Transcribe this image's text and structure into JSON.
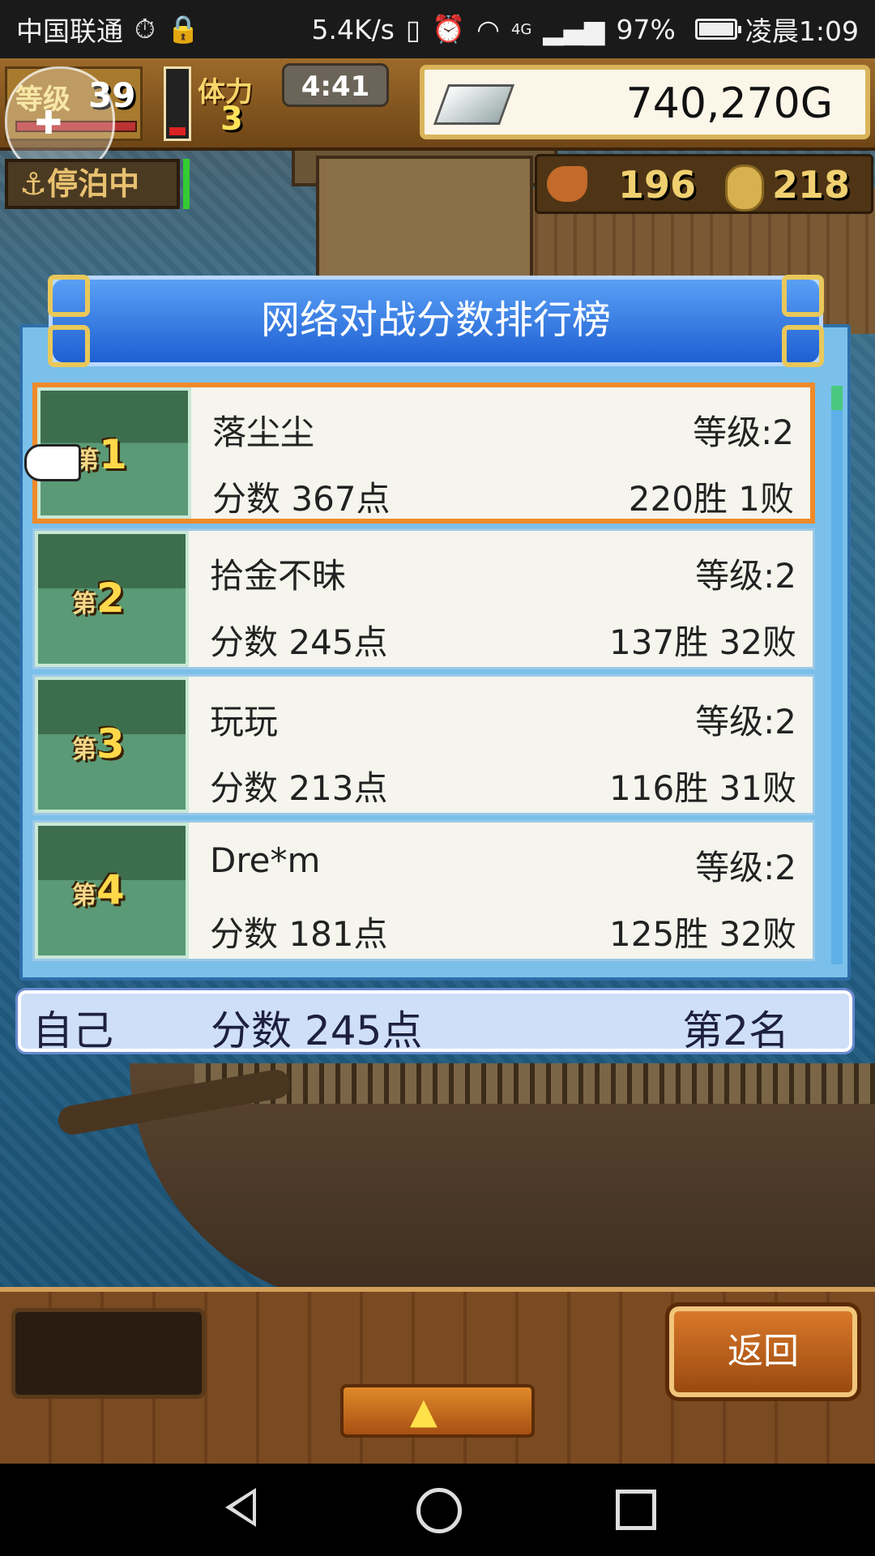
{
  "status_bar": {
    "carrier": "中国联通",
    "network_speed": "5.4K/s",
    "signal_label": "4G",
    "battery": "97%",
    "time": "凌晨1:09"
  },
  "hud": {
    "level_label": "等级",
    "level_value": "39",
    "stamina_label": "体力",
    "stamina_value": "3",
    "timer": "4:41",
    "money": "740,270G",
    "status_label": "停泊中",
    "food_count": "196",
    "coin_count": "218"
  },
  "ranking": {
    "title": "网络对战分数排行榜",
    "rows": [
      {
        "rank": "1",
        "name": "落尘尘",
        "level": "等级:2",
        "score": "分数 367点",
        "record": "220胜 1败"
      },
      {
        "rank": "2",
        "name": "拾金不昧",
        "level": "等级:2",
        "score": "分数 245点",
        "record": "137胜 32败"
      },
      {
        "rank": "3",
        "name": "玩玩",
        "level": "等级:2",
        "score": "分数 213点",
        "record": "116胜 31败"
      },
      {
        "rank": "4",
        "name": "Dre*m",
        "level": "等级:2",
        "score": "分数 181点",
        "record": "125胜 32败"
      }
    ],
    "rank_prefix": "第",
    "self": {
      "label": "自己",
      "score": "分数 245点",
      "rank": "第2名"
    }
  },
  "controls": {
    "back_label": "返回",
    "up_symbol": "▲"
  },
  "colors": {
    "selected_border": "#f08a2a",
    "title_blue": "#1e5fd2",
    "rank_gold": "#ffd94a"
  }
}
